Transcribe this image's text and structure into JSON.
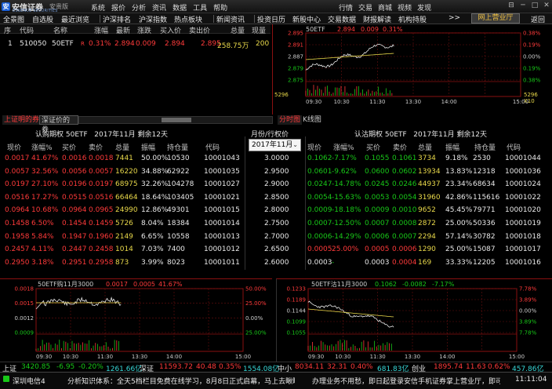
{
  "app": {
    "logo_text": "安信证券",
    "logo_sub": "ESSENCE SECURITIES",
    "version": "安贵版",
    "menu": [
      "系统",
      "报价",
      "分析",
      "资讯",
      "数据",
      "工具",
      "帮助"
    ],
    "menu_right": [
      "行情",
      "交易",
      "商城",
      "视频",
      "发现"
    ],
    "win_buttons": [
      "⊟",
      "─",
      "□",
      "✕"
    ]
  },
  "toolbar": {
    "items": [
      "全景图",
      "自选股",
      "最近浏览",
      "沪深排名",
      "沪深指数",
      "热点板块",
      "新闻资讯",
      "投资日历",
      "新股中心",
      "交易数据",
      "财报解读",
      "机构持股"
    ],
    "more": ">>",
    "online_btn": "网上营业厅",
    "back_btn": "返回"
  },
  "quote_list": {
    "headers": [
      "序",
      "代码",
      "名称",
      "",
      "涨幅",
      "最新",
      "涨跌",
      "买入价",
      "卖出价",
      "总量",
      "现量"
    ],
    "row": {
      "no": "1",
      "code": "510050",
      "name": "50ETF",
      "flag": "R",
      "pct": "0.31%",
      "last": "2.894",
      "chg": "0.009",
      "bid": "2.894",
      "ask": "2.895",
      "vol": "258.75万",
      "cur": "200"
    }
  },
  "intraday": {
    "title": "50ETF",
    "last": "2.894",
    "chg": "0.009",
    "pct": "0.31%",
    "y_left": [
      "2.895",
      "2.891",
      "2.887",
      "2.879",
      "2.875"
    ],
    "y_right": [
      "0.38%",
      "0.19%",
      "0.00%",
      "0.19%",
      "0.38%"
    ],
    "vol_left": "5296",
    "vol_right": "5296",
    "vol_unit": "X10",
    "x_labels": [
      "09:30",
      "10:30",
      "11:30",
      "13:30",
      "14:00",
      "15:00"
    ]
  },
  "tabs": {
    "left": [
      "上证明的券",
      "深证价的券"
    ],
    "right": [
      "分时图",
      "K线图"
    ]
  },
  "options": {
    "call_title": "认购期权 50ETF",
    "call_month": "2017年11月",
    "call_days": "剩余12天",
    "put_title": "认沽期权 50ETF",
    "put_month": "2017年11月",
    "put_days": "剩余12天",
    "mid_header": "月份/行权价",
    "month_select": "2017年11月",
    "call_headers": [
      "现价",
      "涨幅%",
      "买价",
      "卖价",
      "总量",
      "振幅",
      "持仓量",
      "代码"
    ],
    "put_headers": [
      "现价",
      "涨幅%",
      "买价",
      "卖价",
      "总量",
      "振幅",
      "持仓量",
      "代码"
    ],
    "rows": [
      {
        "strike": "3.0000",
        "c": [
          "0.0017",
          "41.67%",
          "0.0016",
          "0.0018",
          "7441",
          "50.00%",
          "10530",
          "10001043"
        ],
        "p": [
          "0.1062",
          "-7.17%",
          "0.1055",
          "0.1061",
          "3734",
          "9.18%",
          "2530",
          "10001044"
        ]
      },
      {
        "strike": "2.9500",
        "c": [
          "0.0057",
          "32.56%",
          "0.0056",
          "0.0057",
          "16220",
          "34.88%",
          "62922",
          "10001035"
        ],
        "p": [
          "0.0601",
          "-9.62%",
          "0.0600",
          "0.0602",
          "13934",
          "13.83%",
          "12318",
          "10001036"
        ]
      },
      {
        "strike": "2.9000",
        "c": [
          "0.0197",
          "27.10%",
          "0.0196",
          "0.0197",
          "68975",
          "32.26%",
          "104278",
          "10001027"
        ],
        "p": [
          "0.0247",
          "-14.78%",
          "0.0245",
          "0.0246",
          "44937",
          "23.34%",
          "68634",
          "10001024"
        ]
      },
      {
        "strike": "2.8500",
        "c": [
          "0.0516",
          "17.27%",
          "0.0515",
          "0.0516",
          "66464",
          "18.64%",
          "103405",
          "10001021"
        ],
        "p": [
          "0.0054",
          "-15.63%",
          "0.0053",
          "0.0054",
          "31960",
          "42.86%",
          "115616",
          "10001022"
        ]
      },
      {
        "strike": "2.8000",
        "c": [
          "0.0964",
          "10.68%",
          "0.0964",
          "0.0965",
          "24990",
          "12.86%",
          "49301",
          "10001015"
        ],
        "p": [
          "0.0009",
          "-18.18%",
          "0.0009",
          "0.0010",
          "9652",
          "45.45%",
          "79771",
          "10001020"
        ]
      },
      {
        "strike": "2.7500",
        "c": [
          "0.1458",
          "6.50%",
          "0.1454",
          "0.1459",
          "5726",
          "8.04%",
          "18384",
          "10001014"
        ],
        "p": [
          "0.0007",
          "-12.50%",
          "0.0007",
          "0.0008",
          "2872",
          "25.00%",
          "50336",
          "10001019"
        ]
      },
      {
        "strike": "2.7000",
        "c": [
          "0.1958",
          "5.84%",
          "0.1947",
          "0.1960",
          "2149",
          "6.65%",
          "10558",
          "10001013"
        ],
        "p": [
          "0.0006",
          "-14.29%",
          "0.0006",
          "0.0007",
          "2294",
          "57.14%",
          "30782",
          "10001018"
        ]
      },
      {
        "strike": "2.6500",
        "c": [
          "0.2457",
          "4.11%",
          "0.2447",
          "0.2458",
          "1014",
          "7.03%",
          "7400",
          "10001012"
        ],
        "p": [
          "0.0005",
          "25.00%",
          "0.0005",
          "0.0006",
          "1290",
          "25.00%",
          "15087",
          "10001017"
        ]
      },
      {
        "strike": "2.6000",
        "c": [
          "0.2950",
          "3.18%",
          "0.2951",
          "0.2958",
          "873",
          "3.99%",
          "8023",
          "10001011"
        ],
        "p": [
          "0.0003",
          "-",
          "0.0003",
          "0.0004",
          "169",
          "33.33%",
          "12205",
          "10001016"
        ]
      }
    ]
  },
  "call_chart": {
    "title": "50ETF购11月3000",
    "last": "0.0017",
    "chg": "0.0005",
    "pct": "41.67%",
    "y_left": [
      "0.0018",
      "0.0015",
      "0.0012",
      "0.0009"
    ],
    "y_right": [
      "50.00%",
      "25.00%",
      "0.00%",
      "25.00%"
    ],
    "x_labels": [
      "09:30",
      "10:30",
      "11:30",
      "13:30",
      "14:00",
      "15:00"
    ]
  },
  "put_chart": {
    "title": "50ETF沽11月3000",
    "last": "0.1062",
    "chg": "-0.0082",
    "pct": "-7.17%",
    "y_left": [
      "0.1233",
      "0.1189",
      "0.1144",
      "0.1099",
      "0.1055"
    ],
    "y_right": [
      "7.78%",
      "3.89%",
      "0.00%",
      "3.89%",
      "7.78%"
    ],
    "x_labels": [
      "09:30",
      "10:30",
      "11:30",
      "13:30",
      "14:00",
      "15:00"
    ]
  },
  "status": {
    "sh_label": "上证",
    "sh_val": "3420.85",
    "sh_chg": "-6.95",
    "sh_pct": "-0.20%",
    "sh_amt": "1261.66亿",
    "sz_label": "深证",
    "sz_val": "11593.72",
    "sz_chg": "40.48",
    "sz_pct": "0.35%",
    "sz_amt": "1554.08亿",
    "zx_label": "中小",
    "zx_val": "8034.11",
    "zx_chg": "32.31",
    "zx_pct": "0.40%",
    "zx_amt": "681.83亿",
    "cy_label": "创业",
    "cy_val": "1895.74",
    "cy_chg": "11.63",
    "cy_pct": "0.62%",
    "cy_amt": "457.86亿",
    "net_label": "深圳电信4",
    "ticker": "分析知识体系：全天5档栏目免费在线学习，8月8日正式启幕，马上去瞅瞅~~",
    "ticker2": "办理业务不用愁，即日起登录安信手机证券掌上营业厅，即可",
    "time": "11:11:04"
  }
}
